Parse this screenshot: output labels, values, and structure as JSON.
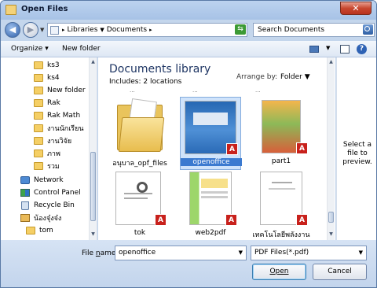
{
  "window": {
    "title": "Open Files",
    "close_glyph": "✕"
  },
  "address": {
    "back_glyph": "◀",
    "forward_glyph": "▶",
    "breadcrumbs": [
      "Libraries",
      "Documents"
    ],
    "refresh_glyph": "⇆",
    "search_placeholder": "Search Documents"
  },
  "toolbar": {
    "organize": "Organize",
    "new_folder": "New folder"
  },
  "sidebar": {
    "items": [
      {
        "label": "ks3",
        "icon": "folder"
      },
      {
        "label": "ks4",
        "icon": "folder"
      },
      {
        "label": "New folder",
        "icon": "folder"
      },
      {
        "label": "Rak",
        "icon": "folder"
      },
      {
        "label": "Rak  Math",
        "icon": "folder"
      },
      {
        "label": "งานนักเรียน",
        "icon": "folder"
      },
      {
        "label": "งานวิจัย",
        "icon": "folder"
      },
      {
        "label": "ภาพ",
        "icon": "folder"
      },
      {
        "label": "รวม",
        "icon": "folder"
      },
      {
        "label": "Network",
        "icon": "network"
      },
      {
        "label": "Control Panel",
        "icon": "control-panel"
      },
      {
        "label": "Recycle Bin",
        "icon": "recycle-bin"
      },
      {
        "label": "น้องจุ๋งจ๋ง",
        "icon": "homegroup"
      },
      {
        "label": "tom",
        "icon": "folder"
      }
    ]
  },
  "library": {
    "title": "Documents library",
    "includes_label": "Includes:",
    "includes_link": "2 locations",
    "arrange_label": "Arrange by:",
    "arrange_value": "Folder",
    "partial_top_labels": [
      "...",
      "...",
      "..."
    ],
    "files": [
      {
        "name": "อนุบาล_opf_files",
        "kind": "folder",
        "pdf": false,
        "selected": false
      },
      {
        "name": "openoffice",
        "kind": "pdf",
        "pdf": true,
        "selected": true
      },
      {
        "name": "part1",
        "kind": "pdf",
        "pdf": true,
        "selected": false
      },
      {
        "name": "tok",
        "kind": "pdf",
        "pdf": true,
        "selected": false
      },
      {
        "name": "web2pdf",
        "kind": "pdf",
        "pdf": true,
        "selected": false
      },
      {
        "name": "เทคโนโลยีพลังงาน",
        "kind": "pdf",
        "pdf": true,
        "selected": false
      }
    ]
  },
  "preview": {
    "text": "Select a file to preview."
  },
  "bottom": {
    "file_name_label_pre": "File ",
    "file_name_label_underlined": "n",
    "file_name_label_post": "ame:",
    "file_name_value": "openoffice",
    "file_type_value": "PDF Files(*.pdf)",
    "open_label": "Open",
    "cancel_label": "Cancel"
  },
  "colors": {
    "accent": "#2e62b4",
    "selection": "#cfe3fb",
    "pdf_red": "#c8211c",
    "folder": "#f5cf65"
  }
}
